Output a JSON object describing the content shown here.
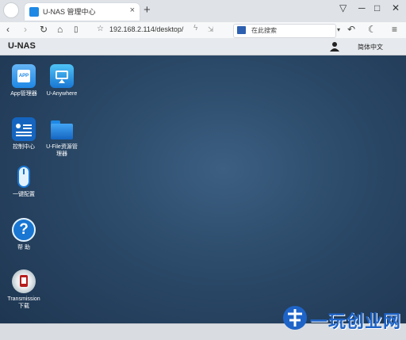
{
  "browser": {
    "tab_title": "U-NAS 管理中心",
    "tab_close": "×",
    "new_tab": "+",
    "url": "192.168.2.114/desktop/",
    "search_text": "在此搜索",
    "window_controls": {
      "minimize": "─",
      "maximize": "□",
      "close": "✕"
    }
  },
  "app": {
    "brand": "U-NAS",
    "language": "简体中文"
  },
  "desktop_icons": [
    {
      "label": "App管理器",
      "icon": "app-store-icon"
    },
    {
      "label": "U-Anywhere",
      "icon": "remote-screen-icon"
    },
    {
      "label": "控制中心",
      "icon": "control-panel-icon"
    },
    {
      "label": "U-File资源管理器",
      "icon": "folder-icon"
    },
    {
      "label": "一键配置",
      "icon": "mouse-icon"
    },
    {
      "label": "帮 助",
      "icon": "help-icon"
    },
    {
      "label": "Transmission下载",
      "icon": "transmission-icon"
    }
  ],
  "watermark": {
    "text": "一玩创业网"
  },
  "colors": {
    "accent": "#1e88e5",
    "desktop": "#2a4867",
    "watermark": "#1e64c8"
  }
}
